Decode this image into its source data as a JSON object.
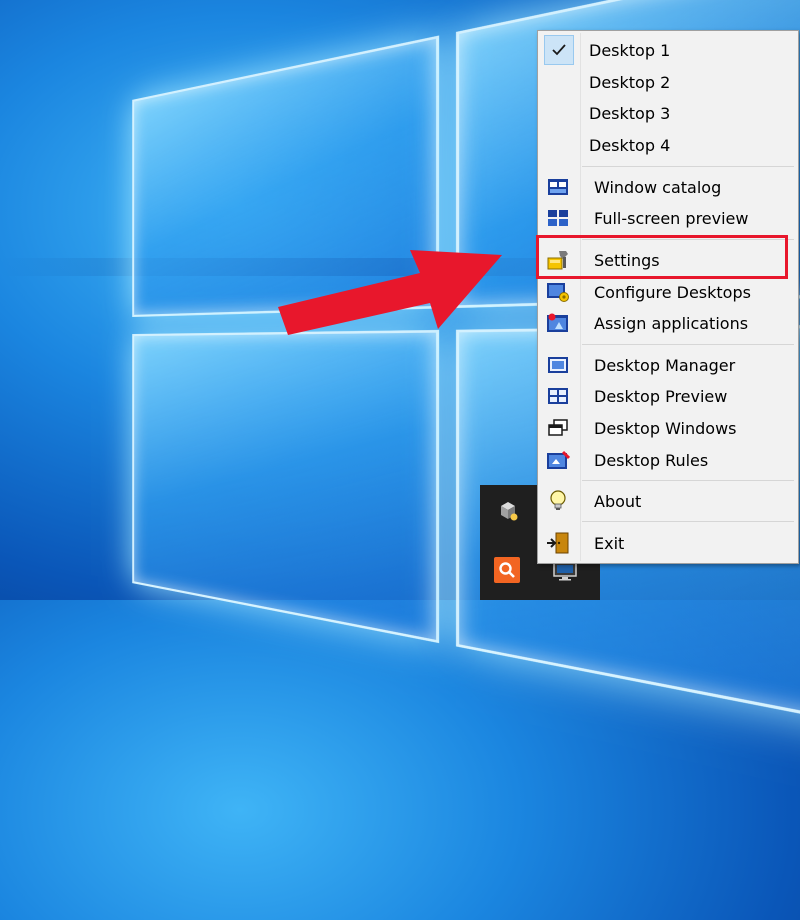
{
  "menu": {
    "desktops": [
      {
        "label": "Desktop 1",
        "checked": true
      },
      {
        "label": "Desktop 2",
        "checked": false
      },
      {
        "label": "Desktop 3",
        "checked": false
      },
      {
        "label": "Desktop 4",
        "checked": false
      }
    ],
    "view_items": [
      {
        "label": "Window catalog",
        "icon": "window-catalog-icon"
      },
      {
        "label": "Full-screen preview",
        "icon": "fullscreen-preview-icon"
      }
    ],
    "config_items": [
      {
        "label": "Settings",
        "icon": "settings-icon",
        "highlighted": true
      },
      {
        "label": "Configure Desktops",
        "icon": "configure-desktops-icon"
      },
      {
        "label": "Assign applications",
        "icon": "assign-applications-icon"
      }
    ],
    "tool_items": [
      {
        "label": "Desktop Manager",
        "icon": "desktop-manager-icon"
      },
      {
        "label": "Desktop Preview",
        "icon": "desktop-preview-icon"
      },
      {
        "label": "Desktop Windows",
        "icon": "desktop-windows-icon"
      },
      {
        "label": "Desktop Rules",
        "icon": "desktop-rules-icon"
      }
    ],
    "about": {
      "label": "About",
      "icon": "lightbulb-icon"
    },
    "exit": {
      "label": "Exit",
      "icon": "exit-door-icon"
    }
  },
  "annotation": {
    "arrow_color": "#e8172c",
    "highlight_color": "#e8172c"
  },
  "tray": {
    "icons": [
      "virtual-machine-icon",
      "search-app-icon",
      "monitor-icon"
    ]
  }
}
